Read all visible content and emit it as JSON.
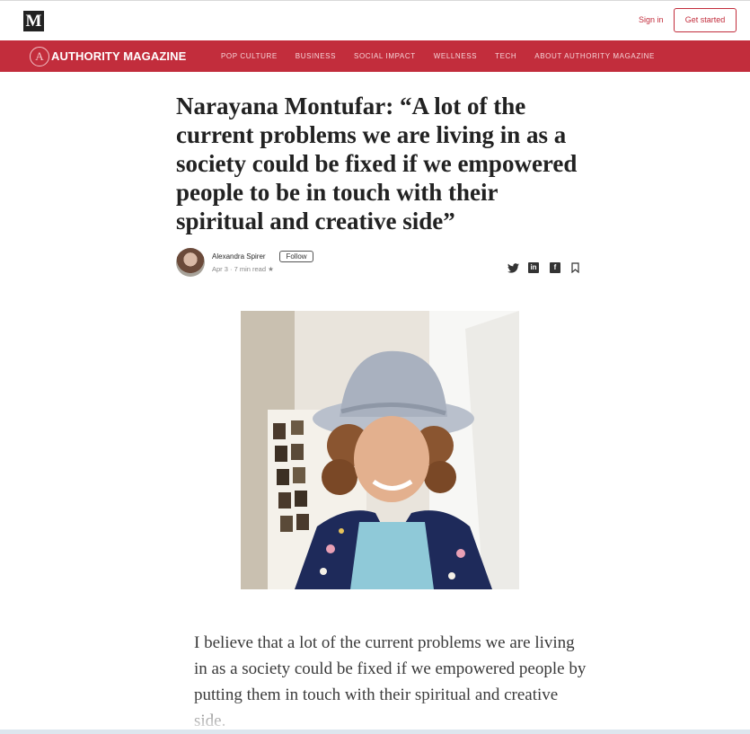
{
  "topbar": {
    "logo_text": "M",
    "signin_label": "Sign in",
    "get_started_label": "Get started"
  },
  "navbar": {
    "brand_mark": "A",
    "brand_name": "AUTHORITY MAGAZINE",
    "items": [
      {
        "label": "POP CULTURE"
      },
      {
        "label": "BUSINESS"
      },
      {
        "label": "SOCIAL IMPACT"
      },
      {
        "label": "WELLNESS"
      },
      {
        "label": "TECH"
      },
      {
        "label": "ABOUT AUTHORITY MAGAZINE"
      }
    ],
    "accent_color": "#c22d3c"
  },
  "article": {
    "title": "Narayana Montufar: “A lot of the current problems we are living in as a society could be fixed if we empowered people to be in touch with their spiritual and creative side”",
    "author": "Alexandra Spirer",
    "follow_label": "Follow",
    "meta": "Apr 3 · 7 min read ★",
    "body": "I believe that a lot of the current problems we are living in as a society could be fixed if we empowered people by putting them in touch with their spiritual and creative side.",
    "share_icons": [
      "twitter-icon",
      "linkedin-icon",
      "facebook-icon",
      "bookmark-icon"
    ]
  }
}
